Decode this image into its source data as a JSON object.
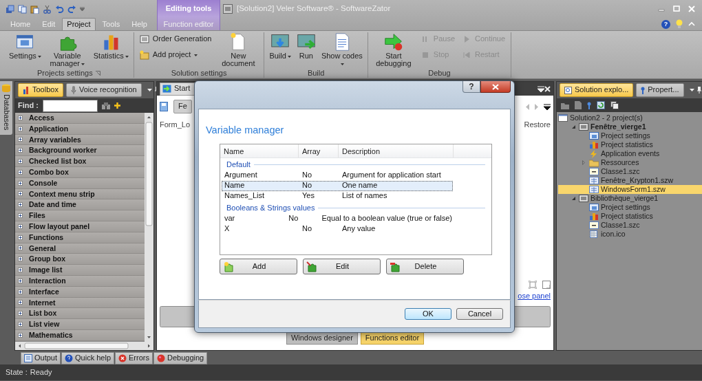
{
  "title_bar": {
    "context_group": "Editing tools",
    "title": "[Solution2] Veler Software® - SoftwareZator",
    "help_button": "?"
  },
  "ribbon_tabs": [
    {
      "label": "Home",
      "selected": false
    },
    {
      "label": "Edit",
      "selected": false
    },
    {
      "label": "Project",
      "selected": true
    },
    {
      "label": "Tools",
      "selected": false
    },
    {
      "label": "Help",
      "selected": false
    }
  ],
  "context_tabs": [
    {
      "label": "Function editor",
      "selected": false
    }
  ],
  "ribbon_groups": [
    {
      "label": "Projects settings",
      "dialog_launcher": true,
      "items": [
        {
          "kind": "large",
          "label": "Settings",
          "dropdown": true,
          "disabled": false
        },
        {
          "kind": "large",
          "label": "Variable manager",
          "dropdown": true,
          "disabled": false
        },
        {
          "kind": "large",
          "label": "Statistics",
          "dropdown": true,
          "disabled": false
        }
      ]
    },
    {
      "label": "Solution settings",
      "dialog_launcher": false,
      "items": [
        {
          "kind": "small",
          "label": "Order Generation",
          "dropdown": false,
          "disabled": false
        },
        {
          "kind": "small",
          "label": "Add project",
          "dropdown": true,
          "disabled": false
        },
        {
          "kind": "large",
          "label": "New document",
          "dropdown": false,
          "disabled": false
        }
      ]
    },
    {
      "label": "Build",
      "dialog_launcher": false,
      "items": [
        {
          "kind": "large",
          "label": "Build",
          "dropdown": true,
          "disabled": false
        },
        {
          "kind": "large",
          "label": "Run",
          "dropdown": false,
          "disabled": false
        },
        {
          "kind": "large",
          "label": "Show codes",
          "dropdown": true,
          "disabled": false
        }
      ]
    },
    {
      "label": "Debug",
      "dialog_launcher": false,
      "items": [
        {
          "kind": "large",
          "label": "Start debugging",
          "dropdown": false,
          "disabled": false
        },
        {
          "kind": "small",
          "label": "Pause",
          "dropdown": false,
          "disabled": true
        },
        {
          "kind": "small",
          "label": "Stop",
          "dropdown": false,
          "disabled": true
        },
        {
          "kind": "small",
          "label": "Continue",
          "dropdown": false,
          "disabled": true
        },
        {
          "kind": "small",
          "label": "Restart",
          "dropdown": false,
          "disabled": true
        }
      ]
    }
  ],
  "side_strip": {
    "label": "Databases"
  },
  "toolbox": {
    "tabs": [
      {
        "label": "Toolbox",
        "selected": true
      },
      {
        "label": "Voice recognition",
        "selected": false
      }
    ],
    "find_label": "Find :",
    "items": [
      "Access",
      "Application",
      "Array variables",
      "Background worker",
      "Checked list box",
      "Combo box",
      "Console",
      "Context menu strip",
      "Date and time",
      "Files",
      "Flow layout panel",
      "Functions",
      "General",
      "Group box",
      "Image list",
      "Interaction",
      "Interface",
      "Internet",
      "List box",
      "List view",
      "Mathematics"
    ]
  },
  "document": {
    "tab": "Start",
    "toolbar_button": "Fe",
    "event_label": "Form_Lo",
    "restore": "Restore",
    "link": "ose panel",
    "view_tabs": [
      {
        "label": "Windows designer",
        "selected": false
      },
      {
        "label": "Functions editor",
        "selected": true
      }
    ]
  },
  "explorer": {
    "tabs": [
      {
        "label": "Solution explo...",
        "selected": true
      },
      {
        "label": "Propert...",
        "selected": false
      }
    ],
    "tree": [
      {
        "label": "Solution2 - 2 project(s)",
        "kind": "solution",
        "selected": false,
        "children": [
          {
            "label": "Fenêtre_vierge1",
            "kind": "project",
            "startup": true,
            "expanded": true,
            "selected": false,
            "children": [
              {
                "label": "Project settings",
                "kind": "settings",
                "selected": false
              },
              {
                "label": "Project statistics",
                "kind": "statistics",
                "selected": false
              },
              {
                "label": "Application events",
                "kind": "events",
                "selected": false
              },
              {
                "label": "Ressources",
                "kind": "folder",
                "expanded": false,
                "selected": false
              },
              {
                "label": "Classe1.szc",
                "kind": "class",
                "selected": false
              },
              {
                "label": "Fenêtre_Krypton1.szw",
                "kind": "form",
                "selected": false
              },
              {
                "label": "WindowsForm1.szw",
                "kind": "form",
                "selected": true
              }
            ]
          },
          {
            "label": "Bibliothèque_vierge1",
            "kind": "project",
            "startup": false,
            "expanded": true,
            "selected": false,
            "children": [
              {
                "label": "Project settings",
                "kind": "settings",
                "selected": false
              },
              {
                "label": "Project statistics",
                "kind": "statistics",
                "selected": false
              },
              {
                "label": "Classe1.szc",
                "kind": "class",
                "selected": false
              },
              {
                "label": "icon.ico",
                "kind": "image",
                "selected": false
              }
            ]
          }
        ]
      }
    ]
  },
  "output_tabs": [
    {
      "label": "Output",
      "selected": false
    },
    {
      "label": "Quick help",
      "selected": false
    },
    {
      "label": "Errors",
      "selected": false
    },
    {
      "label": "Debugging",
      "selected": false
    }
  ],
  "status_bar": {
    "label": "State :",
    "value": "Ready"
  },
  "dialog": {
    "help_button": "?",
    "heading": "Variable manager",
    "columns": [
      "Name",
      "Array",
      "Description"
    ],
    "groups": [
      {
        "label": "Default",
        "rows": [
          {
            "name": "Argument",
            "array": "No",
            "description": "Argument for application start",
            "selected": false
          },
          {
            "name": "Name",
            "array": "No",
            "description": "One name",
            "selected": true
          },
          {
            "name": "Names_List",
            "array": "Yes",
            "description": "List of names",
            "selected": false
          }
        ]
      },
      {
        "label": "Booleans & Strings values",
        "rows": [
          {
            "name": "var",
            "array": "No",
            "description": "Equal to a boolean value (true or false)",
            "selected": false
          },
          {
            "name": "X",
            "array": "No",
            "description": "Any value",
            "selected": false
          }
        ]
      }
    ],
    "actions": [
      "Add",
      "Edit",
      "Delete"
    ],
    "buttons": [
      {
        "label": "OK",
        "default": true
      },
      {
        "label": "Cancel",
        "default": false
      }
    ]
  }
}
